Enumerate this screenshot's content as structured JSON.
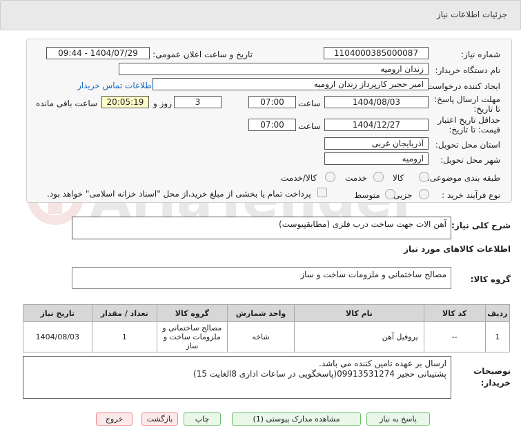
{
  "header": {
    "title": "جزئیات اطلاعات نیاز"
  },
  "form": {
    "need_number_label": "شماره نیاز:",
    "need_number": "1104000385000087",
    "announce_label": "تاریخ و ساعت اعلان عمومی:",
    "announce_value": "1404/07/29 - 09:44",
    "buyer_label": "نام دستگاه خریدار:",
    "buyer_value": "زندان ارومیه",
    "creator_label": "ایجاد کننده درخواست:",
    "creator_value": "امیر حجیر کارپرداز زندان ارومیه",
    "contact_link": "اطلاعات تماس خریدار",
    "deadline_label": "مهلت ارسال پاسخ: تا تاریخ:",
    "deadline_date": "1404/08/03",
    "time_label": "ساعت",
    "deadline_time": "07:00",
    "days_value": "3",
    "days_label": "روز و",
    "remaining_value": "20:05:19",
    "remaining_label": "ساعت باقی مانده",
    "validity_label": "حداقل تاریخ اعتبار قیمت: تا تاریخ:",
    "validity_date": "1404/12/27",
    "validity_time": "07:00",
    "province_label": "استان محل تحویل:",
    "province_value": "آذربایجان غربی",
    "city_label": "شهر محل تحویل:",
    "city_value": "ارومیه",
    "category_label": "طبقه بندی موضوعی:",
    "category_options": [
      "کالا",
      "خدمت",
      "کالا/خدمت"
    ],
    "process_label": "نوع فرآیند خرید :",
    "process_options": [
      "جزیی",
      "متوسط"
    ],
    "payment_note": "پرداخت تمام یا بخشی از مبلغ خرید،از محل \"اسناد خزانه اسلامی\" خواهد بود."
  },
  "summary": {
    "label": "شرح کلی نیاز:",
    "value": "آهن الات جهت ساخت درب فلزی (مطابقپیوست)"
  },
  "goods_section": {
    "title": "اطلاعات کالاهای مورد نیاز",
    "group_label": "گروه کالا:",
    "group_value": "مصالح ساختمانی و ملزومات ساخت و ساز"
  },
  "table": {
    "headers": [
      "ردیف",
      "کد کالا",
      "نام کالا",
      "واحد شمارش",
      "گروه کالا",
      "تعداد / مقدار",
      "تاریخ نیاز"
    ],
    "rows": [
      [
        "1",
        "--",
        "پروفیل آهن",
        "شاخه",
        "مصالح ساختمانی و ملزومات ساخت و ساز",
        "1",
        "1404/08/03"
      ]
    ]
  },
  "notes": {
    "label": "توضیحات خریدار:",
    "line1": "ارسال بر عهده تامین کننده می باشد.",
    "line2": "پشتیبانی حجیر 09913531274(پاسخگویی در ساعات اداری 8الغایت 15)"
  },
  "buttons": {
    "reply": "پاسخ به نیاز",
    "docs": "مشاهده مدارک پیوستی (1)",
    "print": "چاپ",
    "back": "بازگشت",
    "exit": "خروج"
  },
  "colors": {
    "link": "#1565c0",
    "button_border": "#6abf6a",
    "danger_border": "#e88888"
  }
}
